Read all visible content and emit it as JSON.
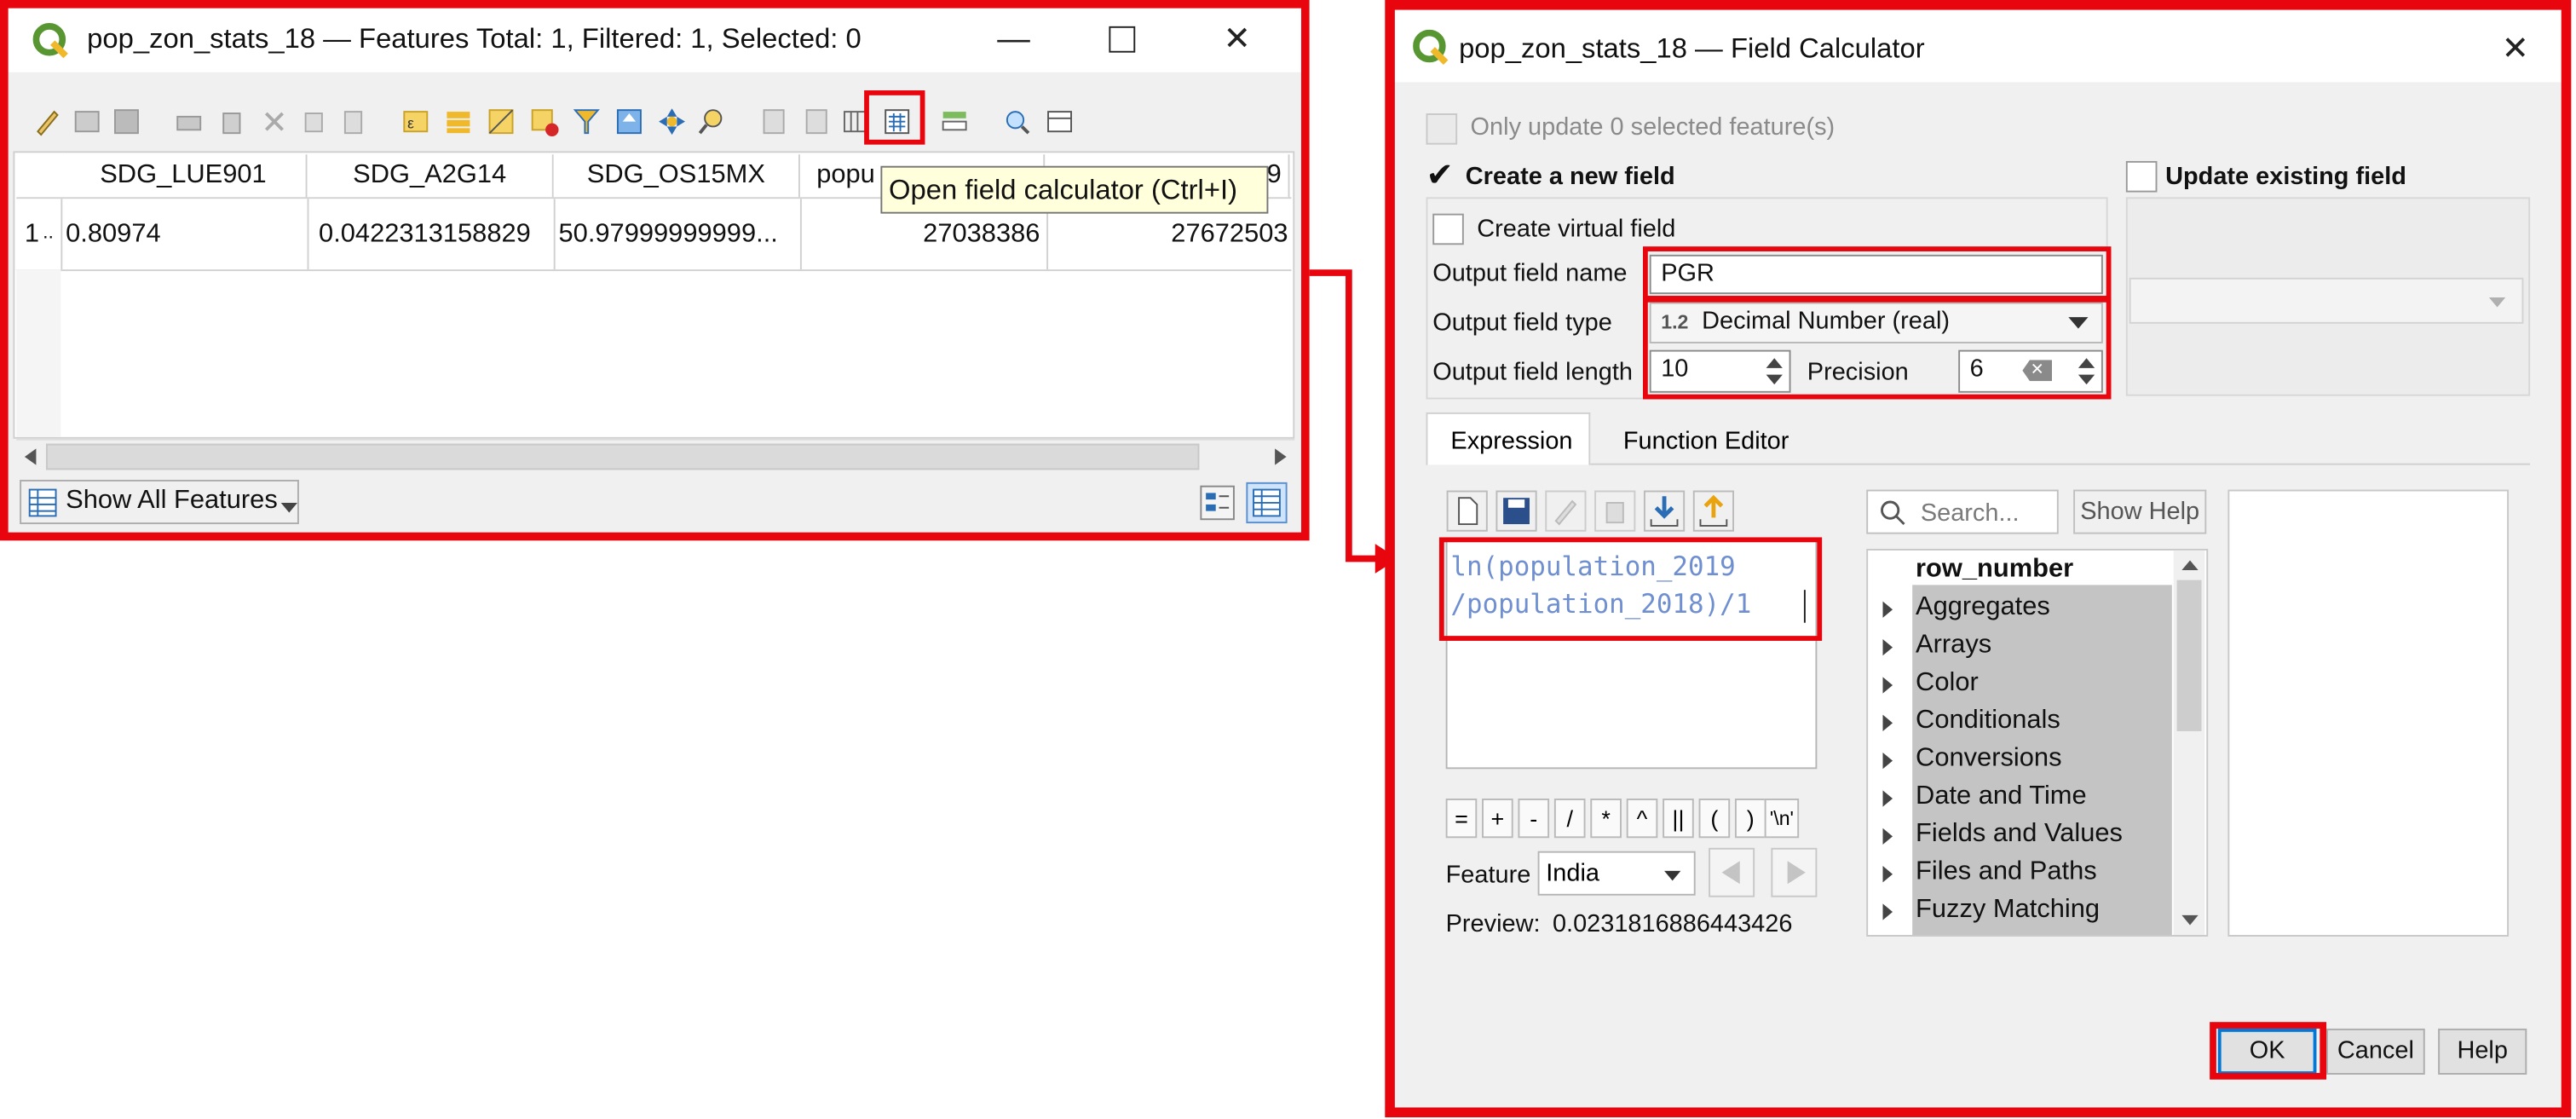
{
  "attr_table": {
    "title": "pop_zon_stats_18 — Features Total: 1, Filtered: 1, Selected: 0",
    "columns": [
      "SDG_LUE901",
      "SDG_A2G14",
      "SDG_OS15MX",
      "popu",
      "9"
    ],
    "row_number": "1",
    "row_marker": "..",
    "row": [
      "0.80974",
      "0.0422313158829",
      "50.97999999999...",
      "27038386",
      "27672503"
    ],
    "tooltip": "Open field calculator (Ctrl+I)",
    "show_all_features": "Show All Features"
  },
  "calc": {
    "title": "pop_zon_stats_18 — Field Calculator",
    "only_update": "Only update 0 selected feature(s)",
    "create_new_field": "Create a new field",
    "update_existing": "Update existing field",
    "create_virtual": "Create virtual field",
    "output_name_label": "Output field name",
    "output_name_value": "PGR",
    "output_type_label": "Output field type",
    "output_type_prefix": "1.2",
    "output_type_value": "Decimal Number (real)",
    "output_length_label": "Output field length",
    "output_length_value": "10",
    "precision_label": "Precision",
    "precision_value": "6",
    "tab_expression": "Expression",
    "tab_function_editor": "Function Editor",
    "expression_line1": "ln(population_2019",
    "expression_line2": "/population_2018)/1",
    "operators": [
      "=",
      "+",
      "-",
      "/",
      "*",
      "^",
      "||",
      "(",
      ")",
      "'\\n'"
    ],
    "feature_label": "Feature",
    "feature_value": "India",
    "preview_label": "Preview:",
    "preview_value": "0.0231816886443426",
    "search_placeholder": "Search...",
    "show_help": "Show Help",
    "tree_items": [
      "row_number",
      "Aggregates",
      "Arrays",
      "Color",
      "Conditionals",
      "Conversions",
      "Date and Time",
      "Fields and Values",
      "Files and Paths",
      "Fuzzy Matching"
    ],
    "ok": "OK",
    "cancel": "Cancel",
    "help": "Help"
  },
  "colors": {
    "highlight": "#e8050d",
    "qgis_green": "#589632",
    "qgis_yellow": "#f0b92b",
    "tooltip_bg": "#ffffdc"
  }
}
